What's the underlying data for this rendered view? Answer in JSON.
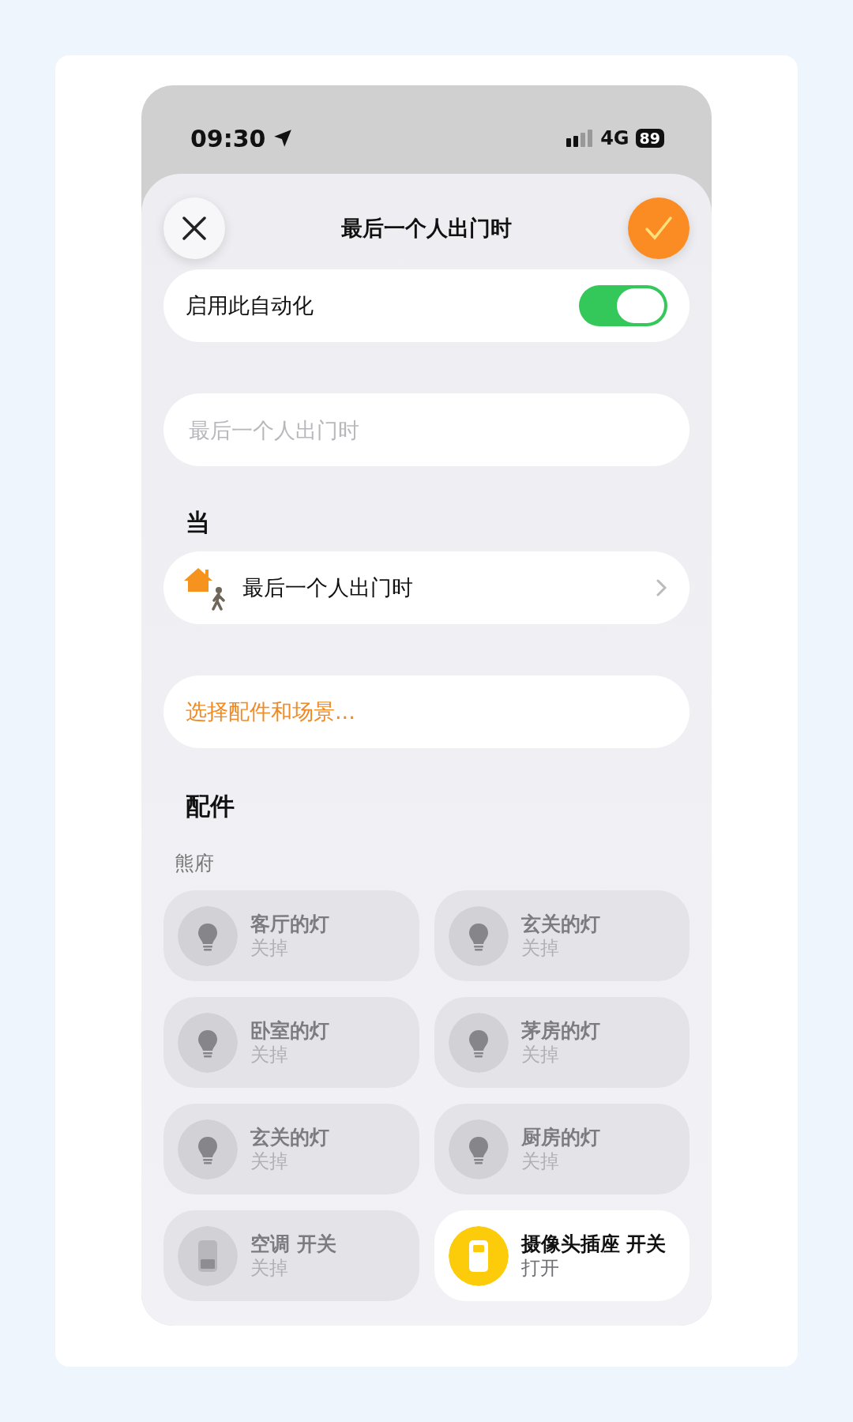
{
  "status_bar": {
    "time": "09:30",
    "network": "4G",
    "battery": "89"
  },
  "header": {
    "title": "最后一个人出门时"
  },
  "enable_row": {
    "label": "启用此自动化",
    "on": true
  },
  "name_field": {
    "placeholder": "最后一个人出门时"
  },
  "trigger_section": {
    "heading": "当",
    "trigger": "最后一个人出门时"
  },
  "select_link": "选择配件和场景...",
  "accessories": {
    "heading": "配件",
    "room": "熊府",
    "tiles": [
      {
        "kind": "light",
        "name": "客厅的灯",
        "state": "关掉",
        "on": false
      },
      {
        "kind": "light",
        "name": "玄关的灯",
        "state": "关掉",
        "on": false
      },
      {
        "kind": "light",
        "name": "卧室的灯",
        "state": "关掉",
        "on": false
      },
      {
        "kind": "light",
        "name": "茅房的灯",
        "state": "关掉",
        "on": false
      },
      {
        "kind": "light",
        "name": "玄关的灯",
        "state": "关掉",
        "on": false
      },
      {
        "kind": "light",
        "name": "厨房的灯",
        "state": "关掉",
        "on": false
      },
      {
        "kind": "switch",
        "name": "空调 开关",
        "state": "关掉",
        "on": false
      },
      {
        "kind": "switch",
        "name": "摄像头插座 开关",
        "state": "打开",
        "on": true
      }
    ]
  }
}
